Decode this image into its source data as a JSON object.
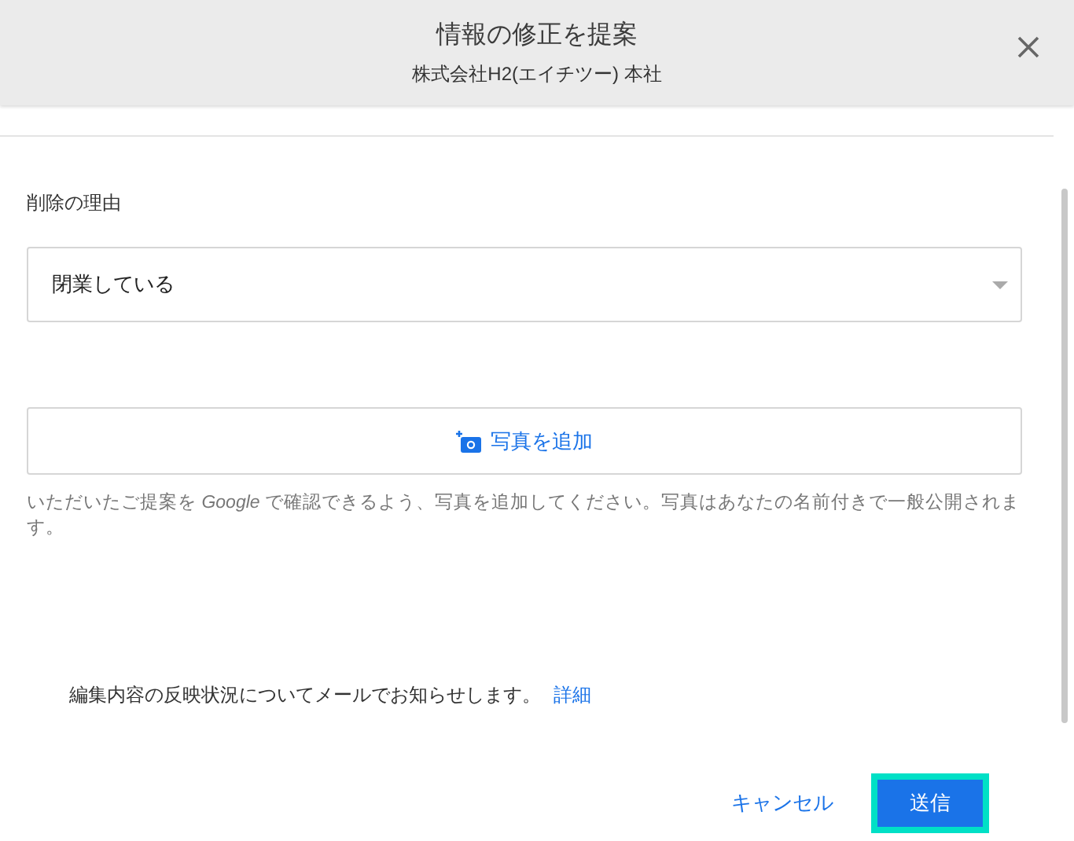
{
  "header": {
    "title": "情報の修正を提案",
    "subtitle": "株式会社H2(エイチツー) 本社"
  },
  "reason": {
    "label": "削除の理由",
    "value": "閉業している"
  },
  "photo": {
    "button": "写真を追加",
    "help": "いただいたご提案を *Google* で確認できるよう、写真を追加してください。写真はあなたの名前付きで一般公開されます。"
  },
  "notice": {
    "text": "編集内容の反映状況についてメールでお知らせします。",
    "link": "詳細"
  },
  "buttons": {
    "cancel": "キャンセル",
    "submit": "送信",
    "submit_focused": true
  }
}
